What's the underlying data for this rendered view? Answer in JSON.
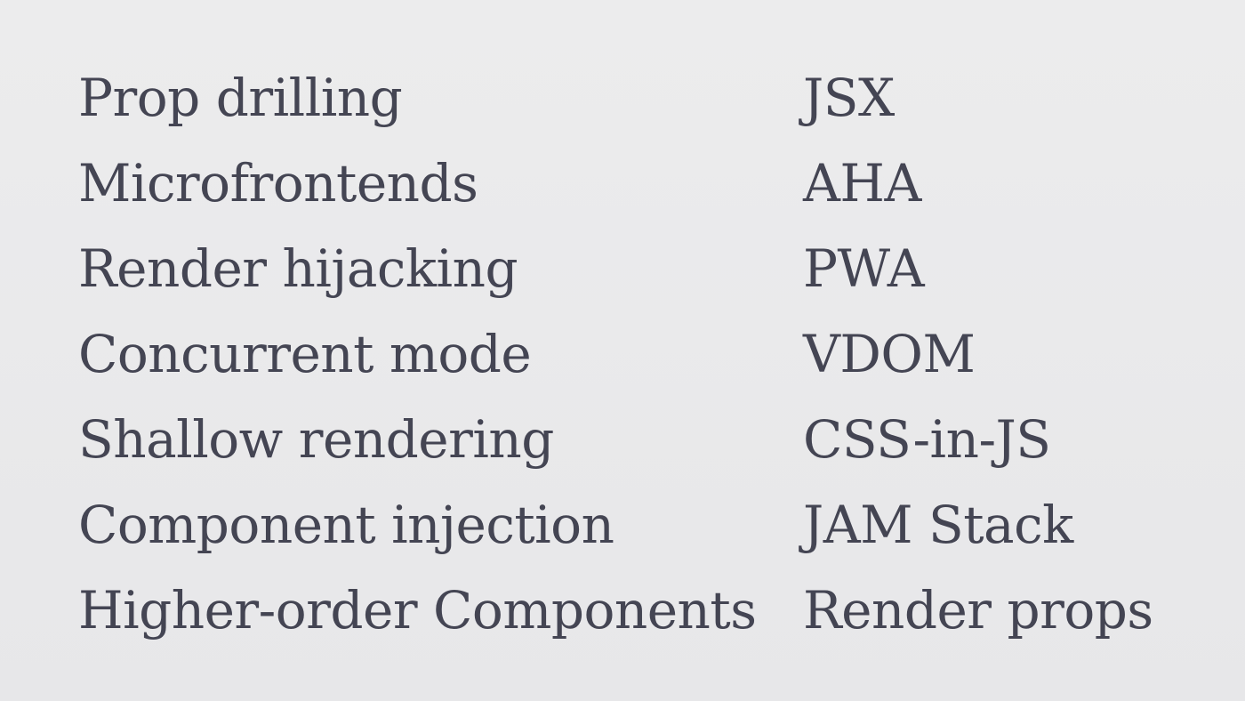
{
  "slide": {
    "left_terms": [
      "Prop drilling",
      "Microfrontends",
      "Render hijacking",
      "Concurrent mode",
      "Shallow rendering",
      "Component injection",
      "Higher-order Components"
    ],
    "right_terms": [
      "JSX",
      "AHA",
      "PWA",
      "VDOM",
      "CSS-in-JS",
      "JAM Stack",
      "Render props"
    ]
  }
}
